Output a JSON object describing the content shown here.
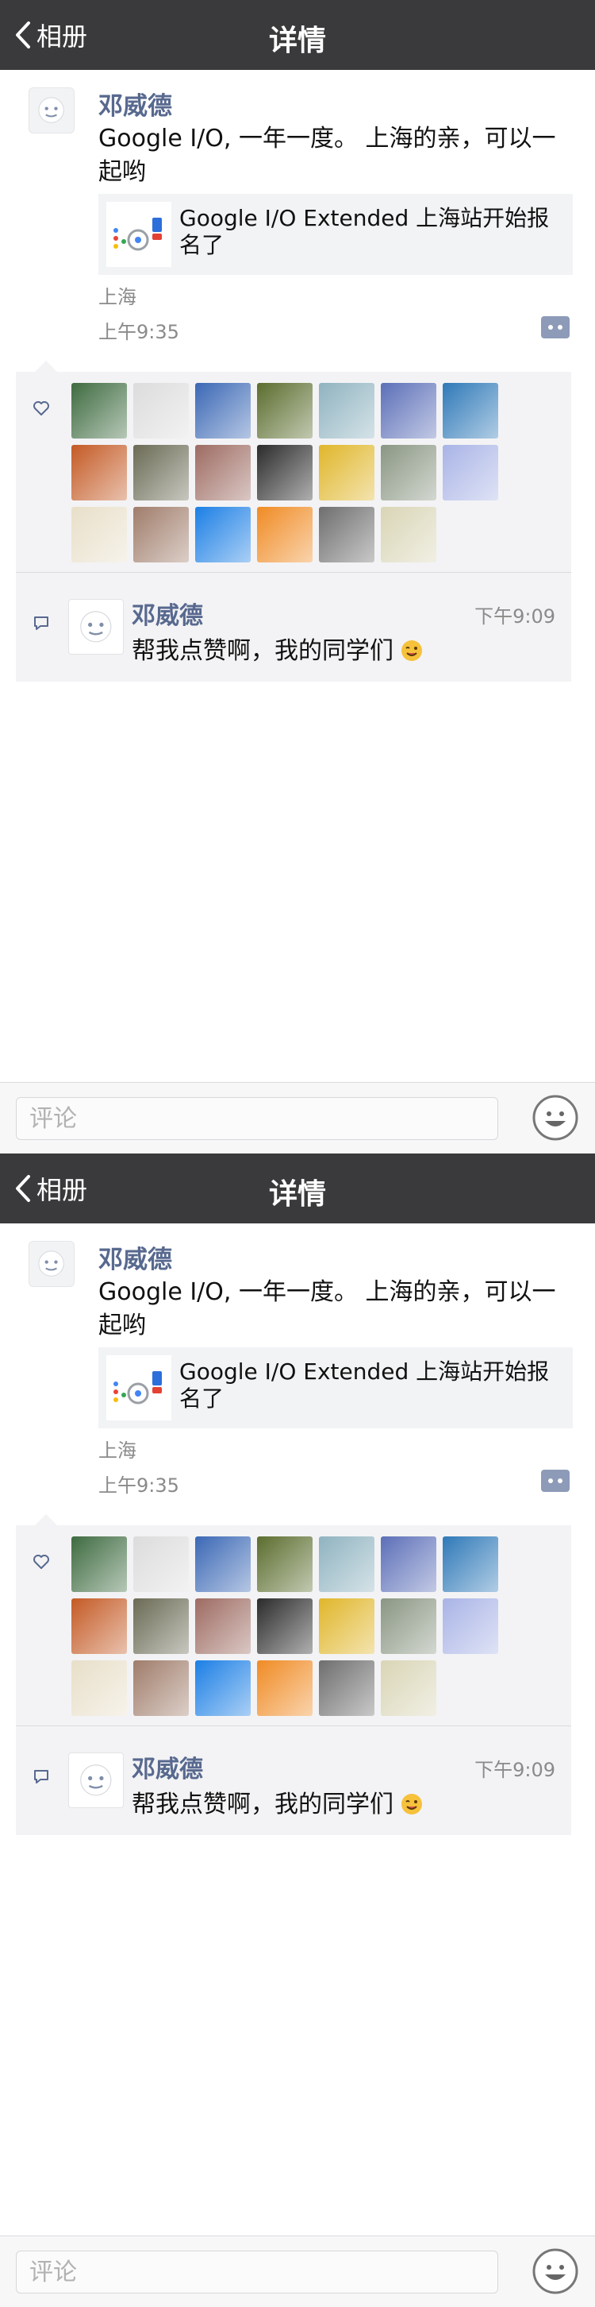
{
  "nav": {
    "back_label": "相册",
    "title": "详情"
  },
  "post": {
    "author": "邓威德",
    "text": "Google I/O, 一年一度。 上海的亲，可以一起哟",
    "link_title": "Google I/O Extended 上海站开始报名了",
    "location": "上海",
    "time": "上午9:35"
  },
  "likes": {
    "avatars": [
      {
        "color": "#3e6b40"
      },
      {
        "color": "#dcdcdc"
      },
      {
        "color": "#3b68b5"
      },
      {
        "color": "#5b6d2e"
      },
      {
        "color": "#8fb3c0"
      },
      {
        "color": "#5c6fb8"
      },
      {
        "color": "#2f79b8"
      },
      {
        "color": "#c45a25"
      },
      {
        "color": "#6a6a55"
      },
      {
        "color": "#9d6b62"
      },
      {
        "color": "#2b2b2b"
      },
      {
        "color": "#e0b62a"
      },
      {
        "color": "#8a9683"
      },
      {
        "color": "#a9b4e6"
      },
      {
        "color": "#e8dfc9"
      },
      {
        "color": "#a07d6b"
      },
      {
        "color": "#1c7fe5"
      },
      {
        "color": "#f08b24"
      },
      {
        "color": "#6e6e6e"
      },
      {
        "color": "#d9d5b6"
      }
    ]
  },
  "comment": {
    "author": "邓威德",
    "time": "下午9:09",
    "text": "帮我点赞啊，我的同学们"
  },
  "input": {
    "placeholder": "评论"
  },
  "colors": {
    "navbar": "#3a3a3c",
    "name": "#58698f",
    "panel": "#f3f3f5"
  },
  "icons": [
    "chevron-left-icon",
    "heart-icon",
    "comment-icon",
    "emoji-icon",
    "more-icon",
    "wink-emoji-icon"
  ]
}
